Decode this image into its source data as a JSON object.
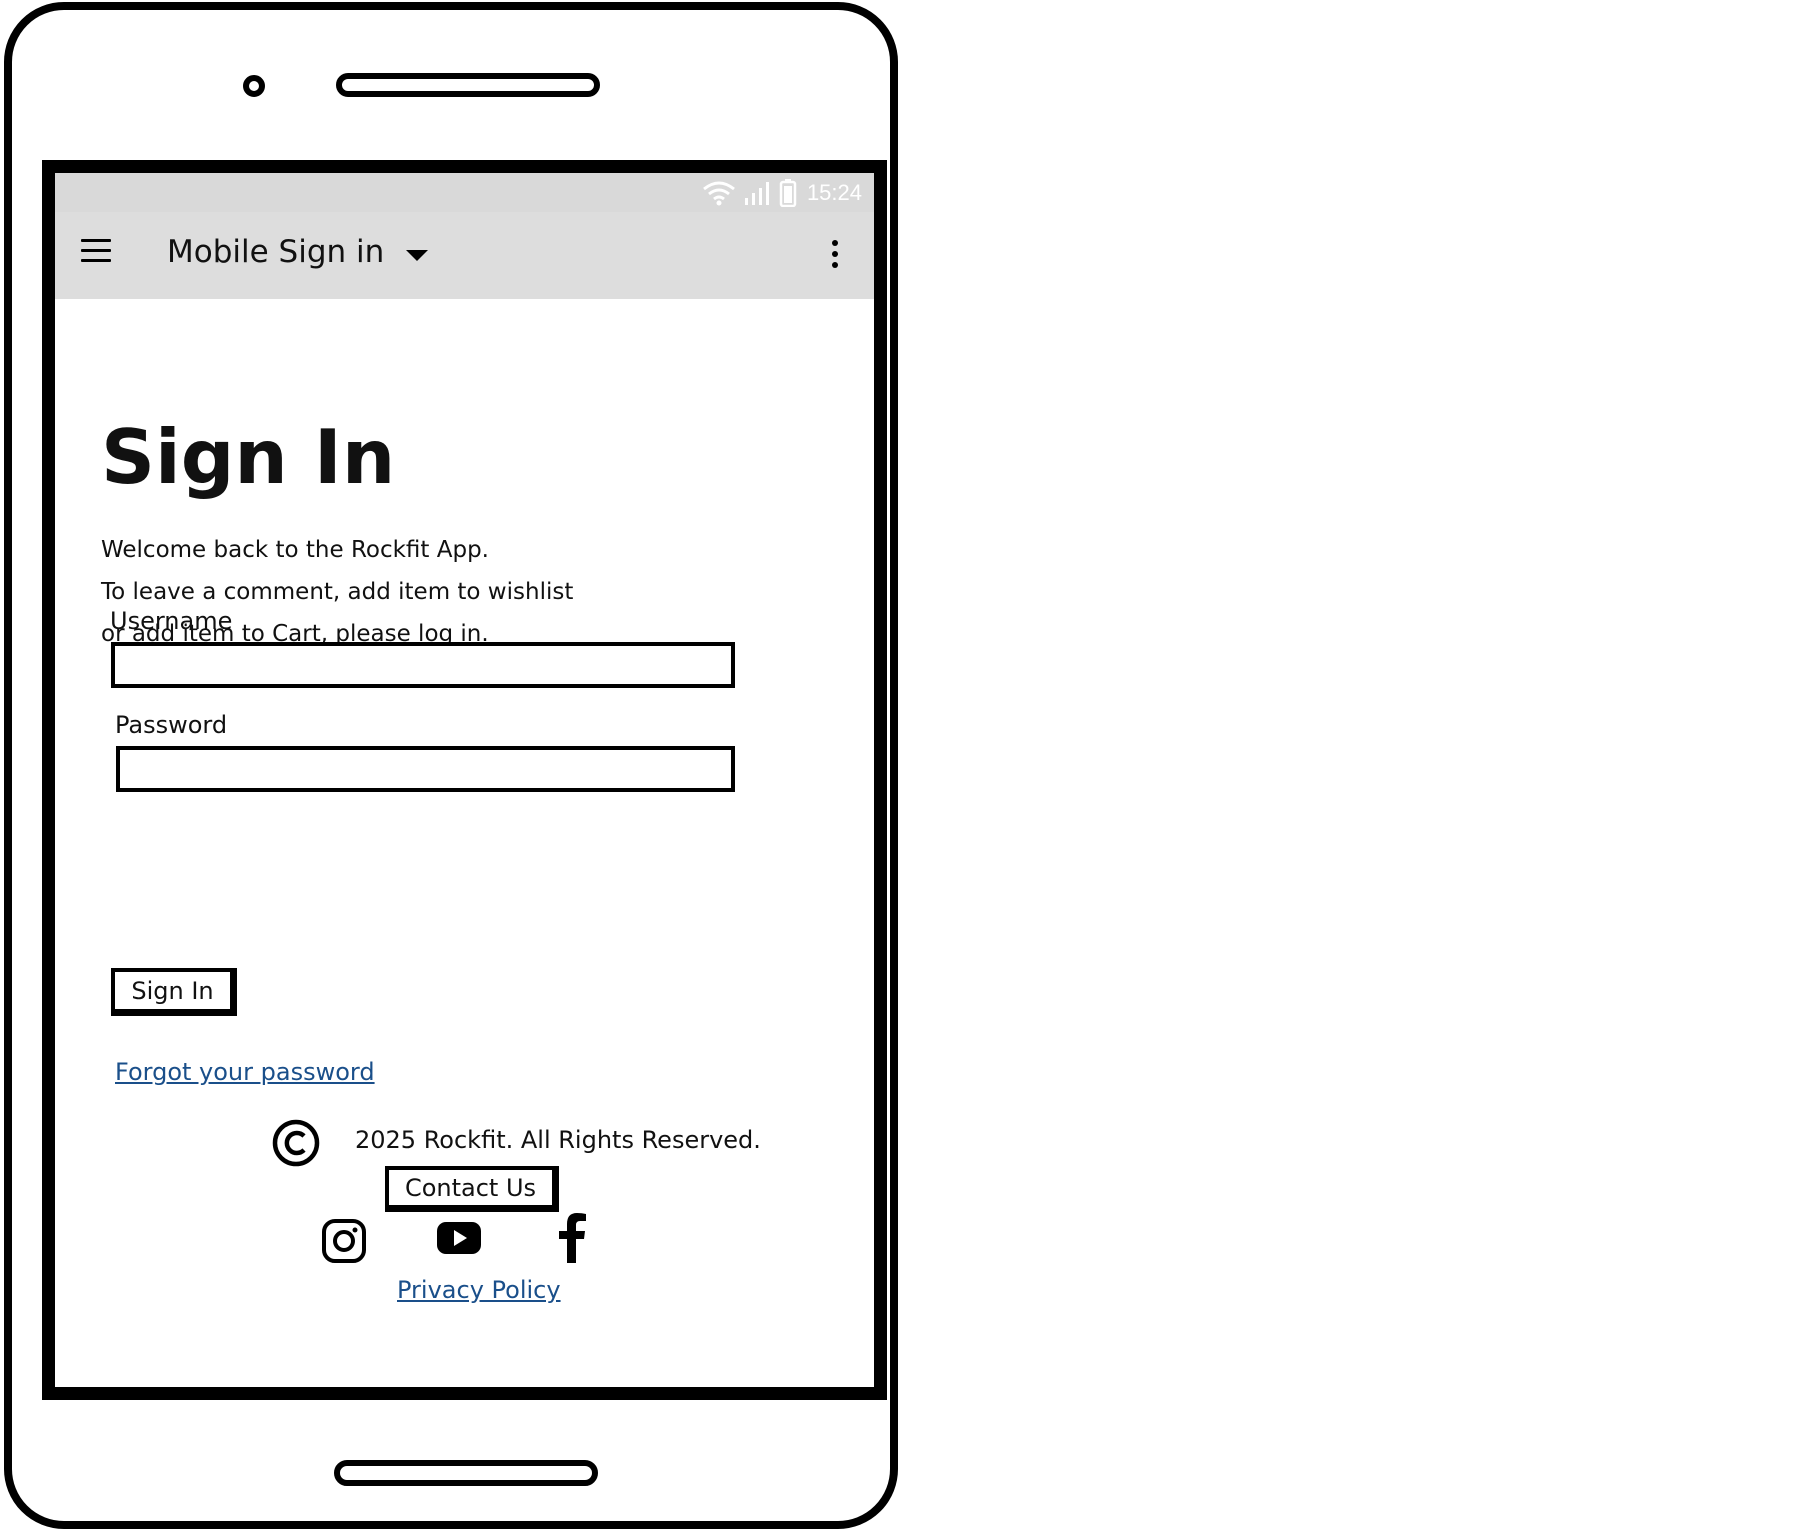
{
  "status_bar": {
    "time": "15:24"
  },
  "app_bar": {
    "title": "Mobile Sign in"
  },
  "page": {
    "title": "Sign In",
    "intro_lines": [
      "Welcome back to the Rockfit App.",
      "To leave a comment, add item to wishlist",
      "or add item to Cart, please log in."
    ]
  },
  "form": {
    "username_label": "Username",
    "username_value": "",
    "password_label": "Password",
    "password_value": "",
    "submit_label": "Sign In",
    "forgot_link": "Forgot your password"
  },
  "footer": {
    "copyright": "2025 Rockfit. All Rights Reserved.",
    "contact_label": "Contact Us",
    "social": [
      "instagram-icon",
      "youtube-icon",
      "facebook-icon"
    ],
    "privacy_link": "Privacy Policy"
  },
  "colors": {
    "status_bar_bg": "#d9d9d9",
    "app_bar_bg": "#dddddd",
    "link": "#1a4f8a"
  }
}
